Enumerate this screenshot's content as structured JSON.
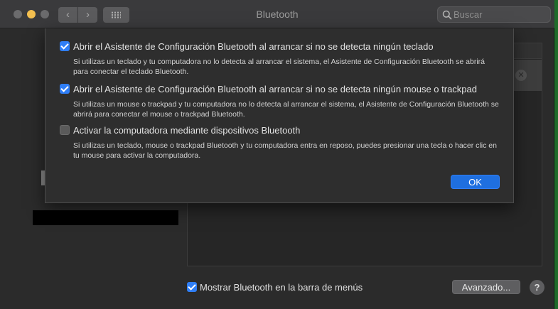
{
  "window": {
    "title": "Bluetooth",
    "search_placeholder": "Buscar"
  },
  "nav": {
    "back_glyph": "‹",
    "forward_glyph": "›"
  },
  "sheet": {
    "options": [
      {
        "checked": true,
        "label": "Abrir el Asistente de Configuración Bluetooth al arrancar si no se detecta ningún teclado",
        "description": "Si utilizas un teclado y tu computadora no lo detecta al arrancar el sistema, el Asistente de Configuración Bluetooth se abrirá para conectar el teclado Bluetooth."
      },
      {
        "checked": true,
        "label": "Abrir el Asistente de Configuración Bluetooth al arrancar si no se detecta ningún mouse o trackpad",
        "description": "Si utilizas un mouse o trackpad y tu computadora no lo detecta al arrancar el sistema, el Asistente de Configuración Bluetooth se abrirá para conectar el mouse o trackpad Bluetooth."
      },
      {
        "checked": false,
        "label": "Activar la computadora mediante dispositivos Bluetooth",
        "description": "Si utilizas un teclado, mouse o trackpad Bluetooth y tu computadora entra en reposo, puedes presionar una tecla o hacer clic en tu mouse para activar la computadora."
      }
    ],
    "ok_label": "OK"
  },
  "footer": {
    "show_in_menu_bar_checked": true,
    "show_in_menu_bar_label": "Mostrar Bluetooth en la barra de menús",
    "advanced_label": "Avanzado...",
    "help_label": "?"
  },
  "colors": {
    "accent": "#2f7ef6",
    "window_bg": "#2b2b2b",
    "titlebar_bg": "#3a3a3c",
    "minimize_yellow": "#f4bf4f"
  },
  "icons": [
    "close-icon",
    "minimize-icon",
    "zoom-icon",
    "back-chevron-icon",
    "forward-chevron-icon",
    "grid-icon",
    "search-icon",
    "checkbox-icon",
    "remove-x-icon",
    "help-icon"
  ]
}
